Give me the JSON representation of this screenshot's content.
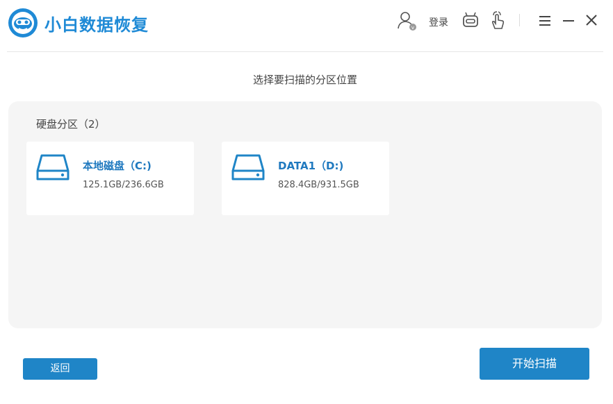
{
  "app": {
    "title": "小白数据恢复",
    "accent_color": "#1f85c7"
  },
  "header": {
    "user_icon": "user-icon",
    "login_label": "登录",
    "robot_icon": "robot-icon",
    "touch_icon": "touch-hand-icon",
    "menu_icon": "menu-icon",
    "minimize_icon": "minimize-icon",
    "close_icon": "close-icon"
  },
  "main": {
    "subtitle": "选择要扫描的分区位置",
    "section_title": "硬盘分区（2）",
    "disks": [
      {
        "name": "本地磁盘（C:)",
        "size": "125.1GB/236.6GB",
        "icon": "hard-drive-icon"
      },
      {
        "name": "DATA1（D:)",
        "size": "828.4GB/931.5GB",
        "icon": "hard-drive-icon"
      }
    ]
  },
  "footer": {
    "back_label": "返回",
    "start_label": "开始扫描"
  }
}
